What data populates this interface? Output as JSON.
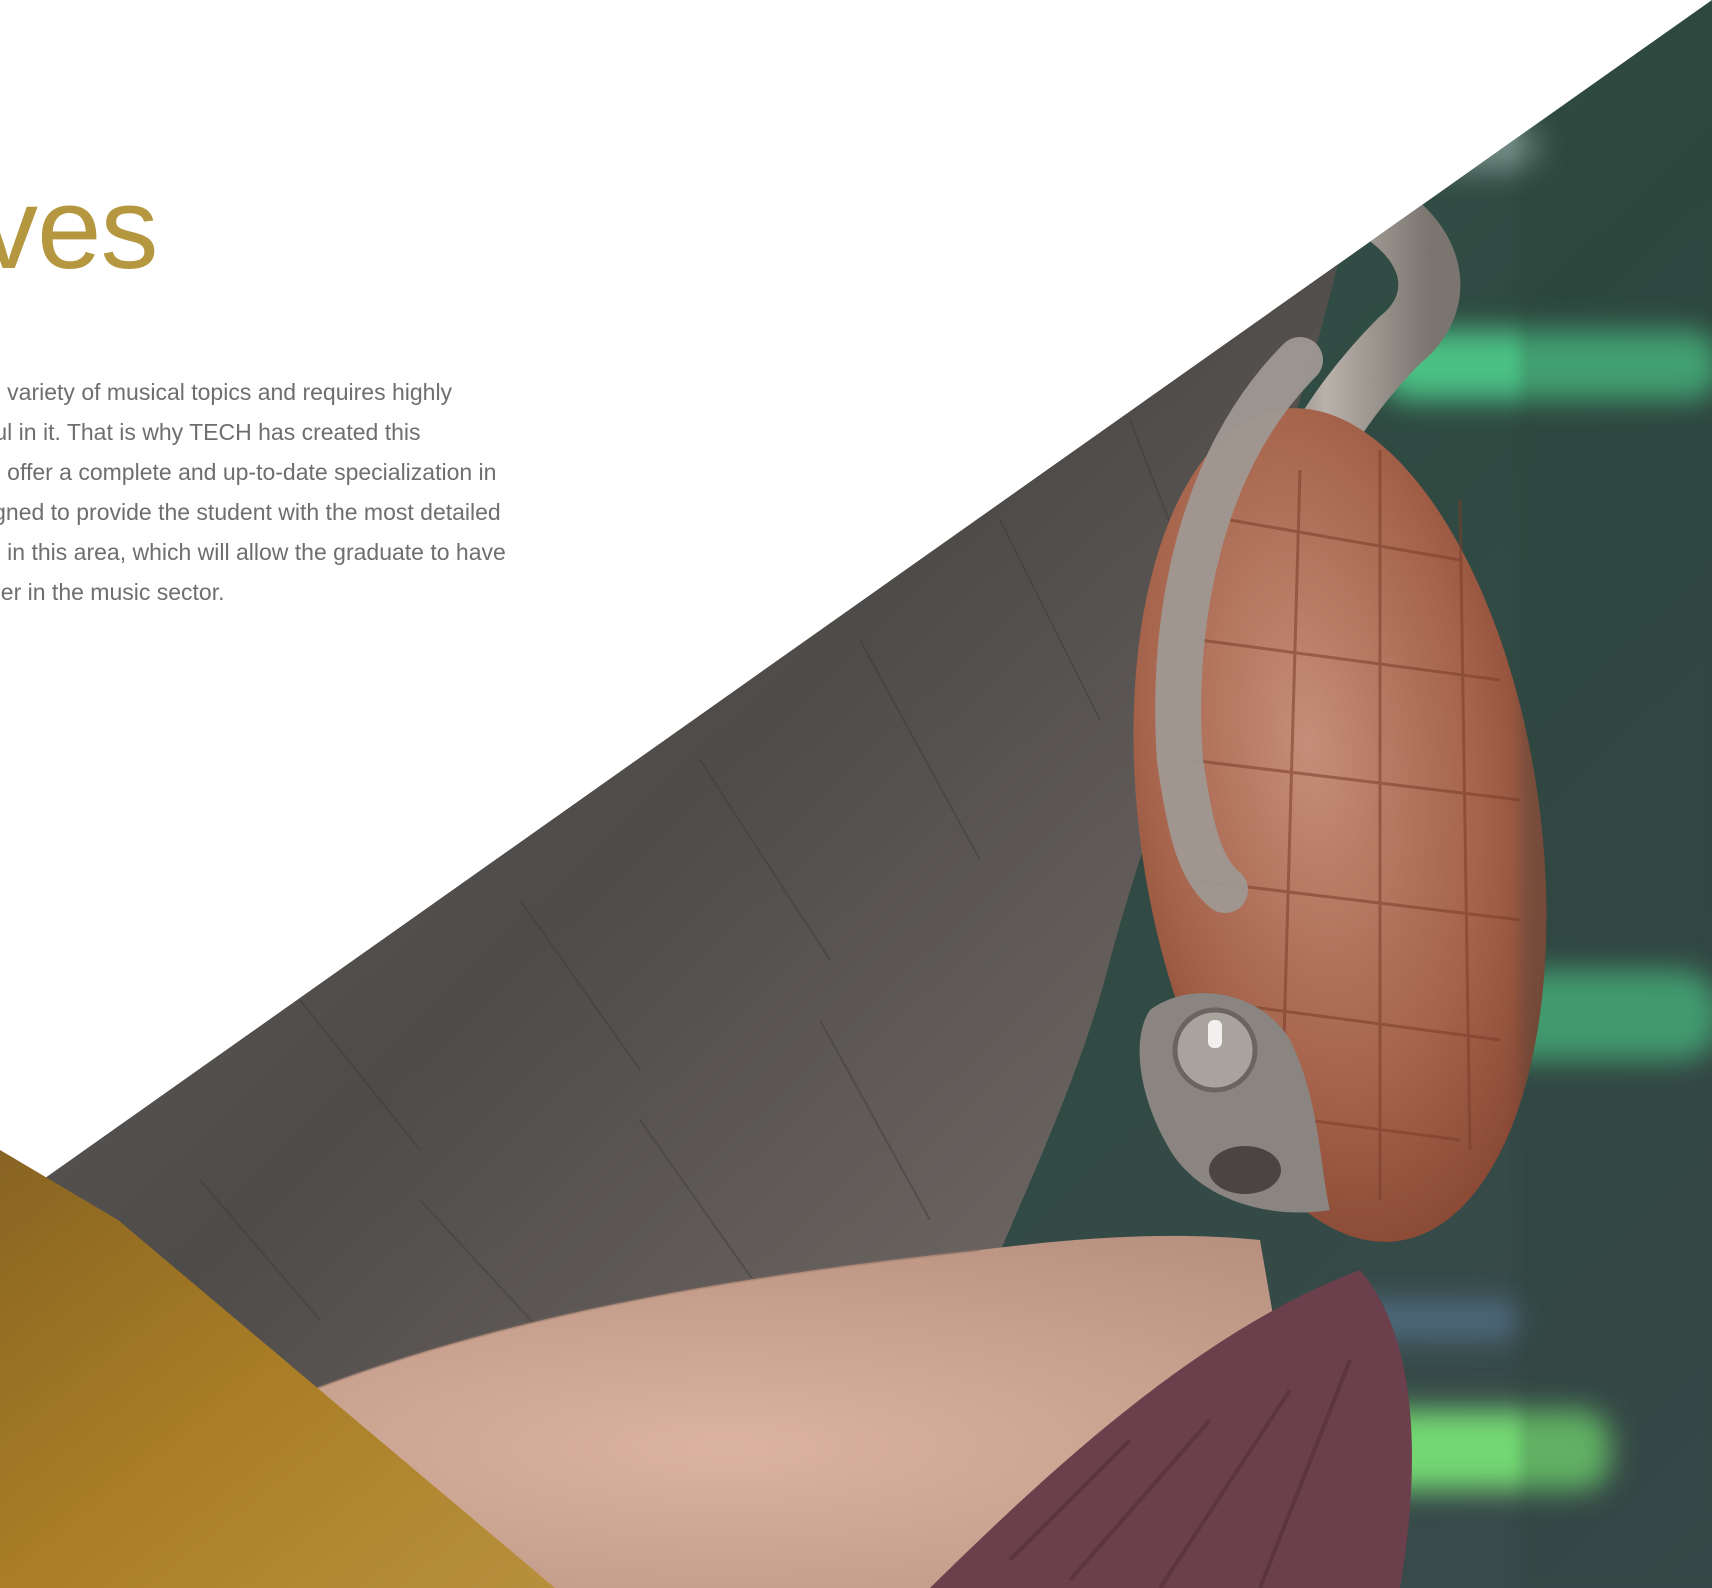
{
  "section": {
    "heading": "ves",
    "body_lines": [
      "e variety of musical topics and requires highly",
      "ful in it. That is why TECH has created this",
      "o offer a complete and up-to-date specialization in",
      "igned to provide the student with the most detailed",
      "e in this area, which will allow the graduate to have",
      "eer in the music sector."
    ]
  },
  "colors": {
    "heading": "#b4973f",
    "body_text": "#6e6e6e",
    "gold_wedge": "#b88a2a",
    "background": "#ffffff"
  },
  "image": {
    "subject": "person-wearing-brown-leather-headphones-in-recording-studio"
  }
}
